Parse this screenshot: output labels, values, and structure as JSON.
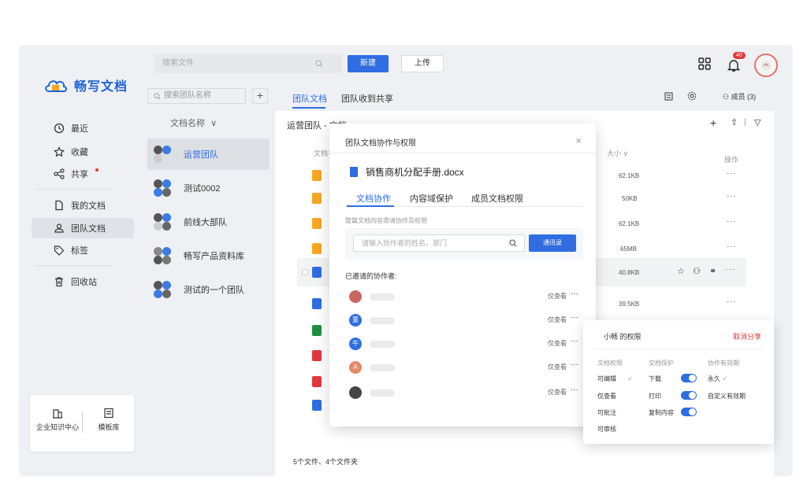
{
  "app": {
    "logo_text": "畅写文档",
    "top_search_placeholder": "搜索文件",
    "new_label": "新建",
    "upload_label": "上传",
    "notif_count": "40"
  },
  "sidebar": {
    "items": [
      {
        "label": "最近",
        "icon": "clock-icon"
      },
      {
        "label": "收藏",
        "icon": "star-icon"
      },
      {
        "label": "共享",
        "icon": "share-icon"
      },
      {
        "label": "我的文档",
        "icon": "document-icon"
      },
      {
        "label": "团队文档",
        "icon": "team-icon"
      },
      {
        "label": "标签",
        "icon": "tag-icon"
      },
      {
        "label": "回收站",
        "icon": "trash-icon"
      }
    ],
    "bottom": {
      "knowledge_label": "企业知识中心",
      "template_label": "模板库"
    }
  },
  "teams": {
    "search_placeholder": "搜索团队名称",
    "header": "文档名称",
    "items": [
      "运营团队",
      "测试0002",
      "前线大部队",
      "畅写产品资料库",
      "测试的一个团队"
    ]
  },
  "main": {
    "tabs": [
      "团队文档",
      "团队收到共享"
    ],
    "members_label": "成员 (3)",
    "breadcrumb": "运营团队 - 文档",
    "col_name": "文档名",
    "col_size": "大小",
    "col_ops": "操作",
    "sizes": [
      "62.1KB",
      "50KB",
      "62.1KB",
      "65MB",
      "40.8KB",
      "39.5KB"
    ],
    "footer": "5个文件、4个文件夹"
  },
  "dialog": {
    "title": "团队文档协作与权限",
    "file_name": "销售商机分配手册.docx",
    "tabs": [
      "文档协作",
      "内容域保护",
      "成员文档权限"
    ],
    "hint": "整篇文档内容邀请协作及权限",
    "invite_placeholder": "请输入协作者的姓名、部门",
    "invite_button": "通讯录",
    "invited_title": "已邀请的协作者:",
    "collaborators": [
      {
        "avatar": "",
        "perm": "仅查看"
      },
      {
        "avatar": "董",
        "perm": "仅查看"
      },
      {
        "avatar": "牛",
        "perm": "仅查看"
      },
      {
        "avatar": "A",
        "perm": "仅查看"
      },
      {
        "avatar": "",
        "perm": "仅查看"
      }
    ]
  },
  "perm_popup": {
    "title": "小畅 的权限",
    "cancel": "取消分享",
    "col1_head": "文档权限",
    "col2_head": "文档保护",
    "col3_head": "协作有效期",
    "doc_perms": [
      "可编辑",
      "仅查看",
      "可批注",
      "可审核"
    ],
    "protections": [
      "下载",
      "打印",
      "复制内容"
    ],
    "validity": [
      "永久",
      "自定义有效期"
    ]
  },
  "colors": {
    "accent": "#2f6de1",
    "danger": "#e0383e"
  }
}
